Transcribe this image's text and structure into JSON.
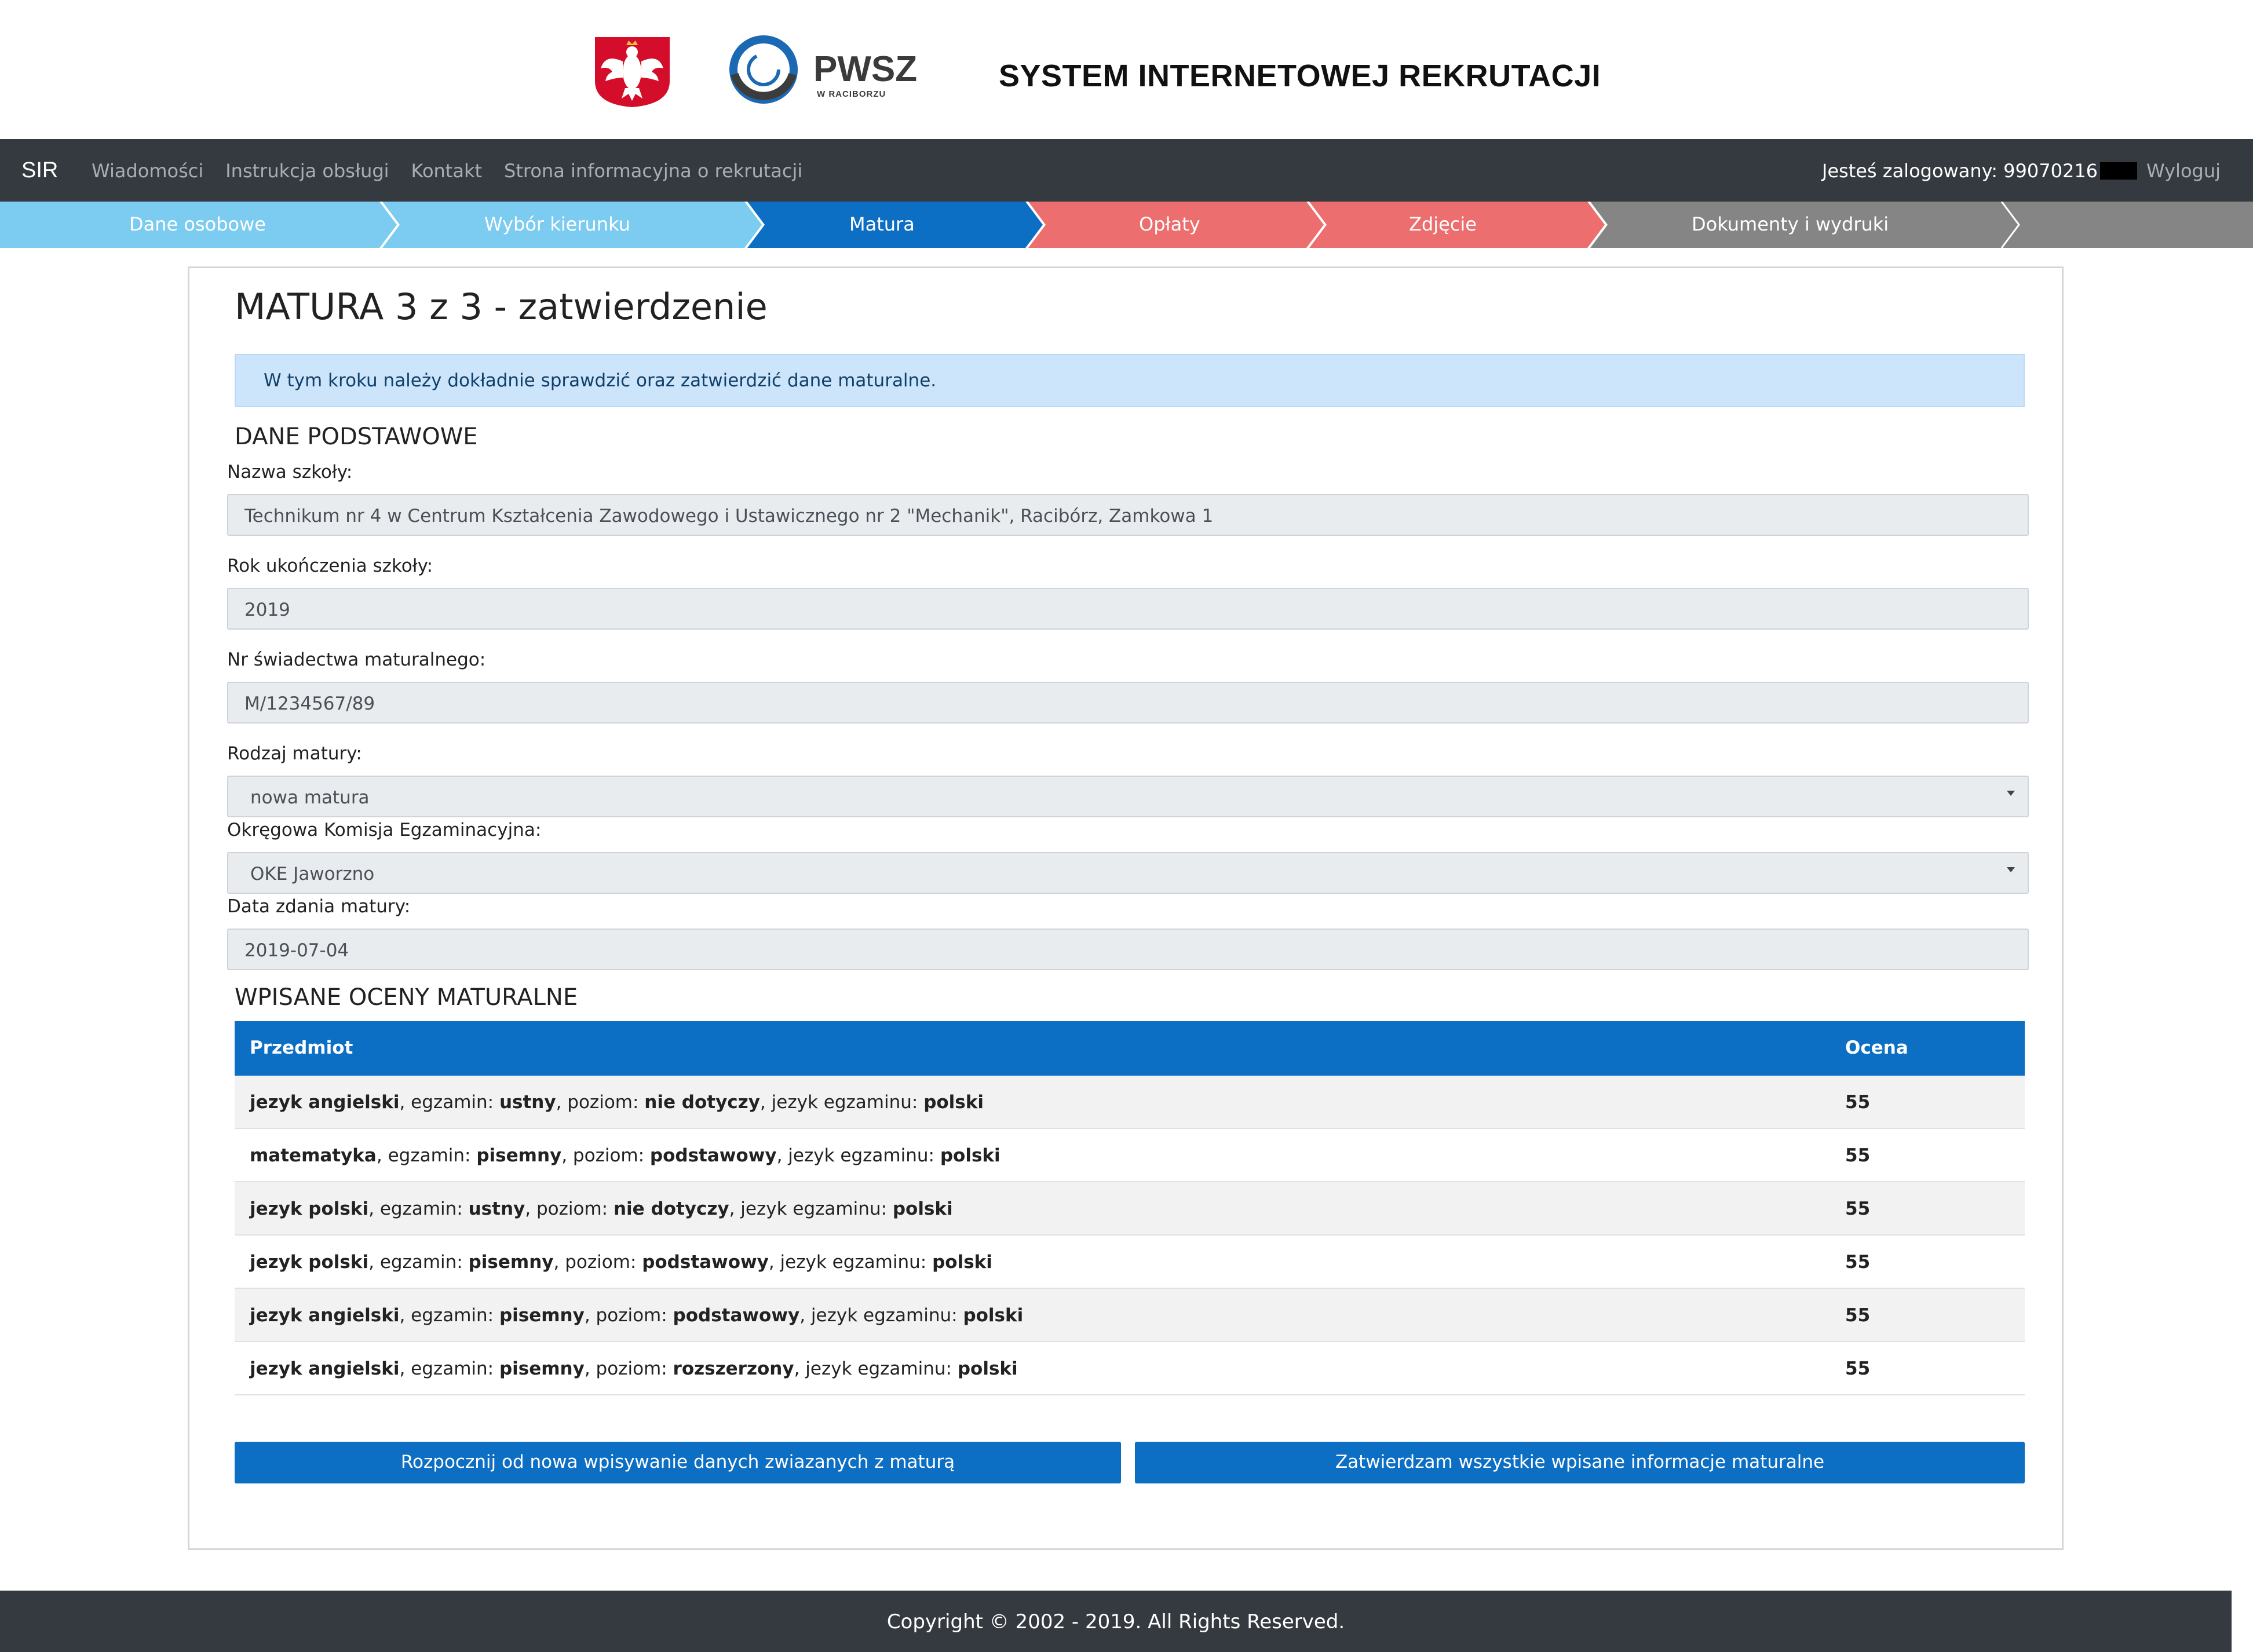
{
  "header": {
    "title": "SYSTEM INTERNETOWEJ REKRUTACJI",
    "logo_text": "PWSZ",
    "logo_subtext": "W RACIBORZU",
    "emblem_icon": "polish-eagle-emblem-icon"
  },
  "navbar": {
    "brand": "SIR",
    "links": [
      "Wiadomości",
      "Instrukcja obsługi",
      "Kontakt",
      "Strona informacyjna o rekrutacji"
    ],
    "logged_in_label": "Jesteś zalogowany: 99070216",
    "logout": "Wyloguj"
  },
  "steps": [
    {
      "label": "Dane osobowe",
      "color": "#7ccbf0"
    },
    {
      "label": "Wybór kierunku",
      "color": "#7ccbf0"
    },
    {
      "label": "Matura",
      "color": "#0d6fc4"
    },
    {
      "label": "Opłaty",
      "color": "#ec6e6e"
    },
    {
      "label": "Zdjęcie",
      "color": "#ec6e6e"
    },
    {
      "label": "Dokumenty i wydruki",
      "color": "#858585"
    }
  ],
  "main": {
    "title": "MATURA 3 z 3 - zatwierdzenie",
    "alert": "W tym kroku należy dokładnie sprawdzić oraz zatwierdzić dane maturalne.",
    "basic_section": "DANE PODSTAWOWE",
    "fields": {
      "school_label": "Nazwa szkoły:",
      "school_value": "Technikum nr 4 w Centrum Kształcenia Zawodowego i Ustawicznego nr 2 \"Mechanik\", Racibórz, Zamkowa 1",
      "year_label": "Rok ukończenia szkoły:",
      "year_value": "2019",
      "cert_label": "Nr świadectwa maturalnego:",
      "cert_value": "M/1234567/89",
      "type_label": "Rodzaj matury:",
      "type_value": "nowa matura",
      "oke_label": "Okręgowa Komisja Egzaminacyjna:",
      "oke_value": "OKE Jaworzno",
      "date_label": "Data zdania matury:",
      "date_value": "2019-07-04"
    },
    "grades_section": "WPISANE OCENY MATURALNE",
    "table": {
      "headers": [
        "Przedmiot",
        "Ocena"
      ],
      "rows": [
        {
          "subject": "jezyk angielski",
          "exam": "ustny",
          "level": "nie dotyczy",
          "language": "polski",
          "grade": "55"
        },
        {
          "subject": "matematyka",
          "exam": "pisemny",
          "level": "podstawowy",
          "language": "polski",
          "grade": "55"
        },
        {
          "subject": "jezyk polski",
          "exam": "ustny",
          "level": "nie dotyczy",
          "language": "polski",
          "grade": "55"
        },
        {
          "subject": "jezyk polski",
          "exam": "pisemny",
          "level": "podstawowy",
          "language": "polski",
          "grade": "55"
        },
        {
          "subject": "jezyk angielski",
          "exam": "pisemny",
          "level": "podstawowy",
          "language": "polski",
          "grade": "55"
        },
        {
          "subject": "jezyk angielski",
          "exam": "pisemny",
          "level": "rozszerzony",
          "language": "polski",
          "grade": "55"
        }
      ],
      "exam_prefix": ", egzamin: ",
      "level_prefix": ", poziom: ",
      "language_prefix": ", jezyk egzaminu: "
    },
    "buttons": {
      "restart": "Rozpocznij od nowa wpisywanie danych zwiazanych z maturą",
      "confirm": "Zatwierdzam wszystkie wpisane informacje maturalne"
    }
  },
  "footer": {
    "copyright": "Copyright © 2002 - 2019. All Rights Reserved."
  },
  "colors": {
    "navbar": "#343a40",
    "primary": "#0d6fc4",
    "step_done": "#7ccbf0",
    "step_pending": "#ec6e6e",
    "step_last": "#858585",
    "alert_bg": "#cce5fb"
  }
}
